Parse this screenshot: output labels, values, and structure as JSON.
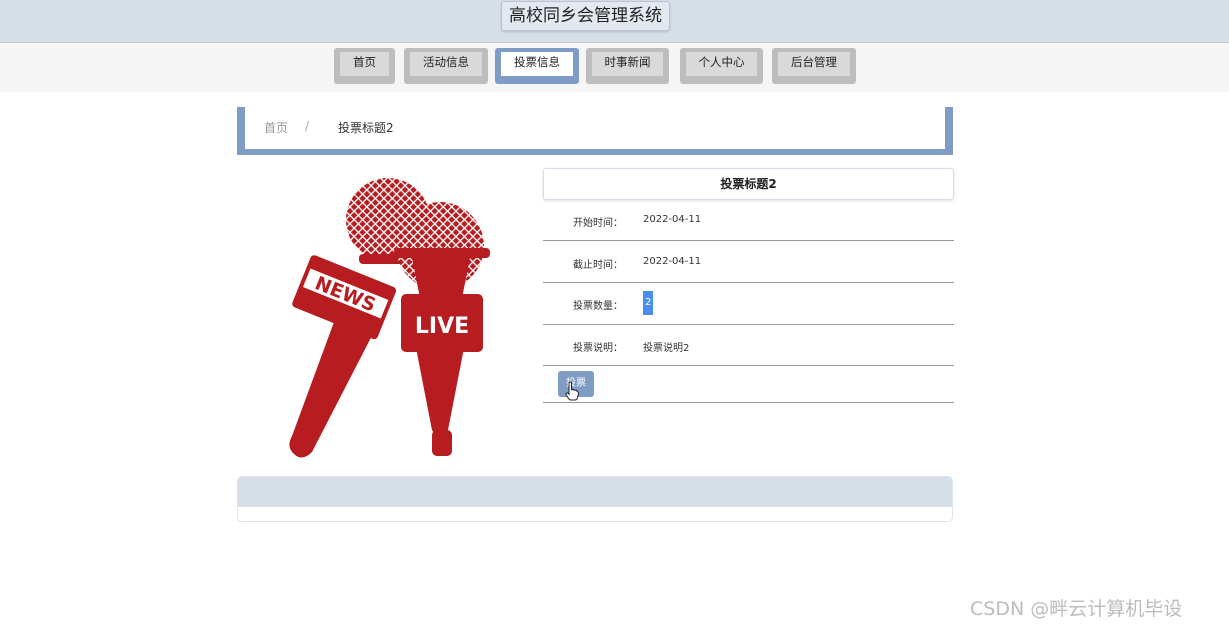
{
  "app": {
    "title": "高校同乡会管理系统"
  },
  "nav": {
    "items": [
      {
        "label": "首页"
      },
      {
        "label": "活动信息"
      },
      {
        "label": "投票信息"
      },
      {
        "label": "时事新闻"
      },
      {
        "label": "个人中心"
      },
      {
        "label": "后台管理"
      }
    ],
    "active_index": 2
  },
  "breadcrumb": {
    "home": "首页",
    "separator": "/",
    "current": "投票标题2"
  },
  "image": {
    "badge_news": "NEWS",
    "badge_live": "LIVE"
  },
  "detail": {
    "title": "投票标题2",
    "fields": [
      {
        "label": "开始时间：",
        "value": "2022-04-11"
      },
      {
        "label": "截止时间：",
        "value": "2022-04-11"
      },
      {
        "label": "投票数量：",
        "value": "2"
      },
      {
        "label": "投票说明：",
        "value": "投票说明2"
      }
    ],
    "vote_button": "投票"
  },
  "watermark": "CSDN @畔云计算机毕设",
  "colors": {
    "accent": "#7f9cc5",
    "header_bg": "#d6dee8",
    "mic_red": "#b71c20"
  }
}
